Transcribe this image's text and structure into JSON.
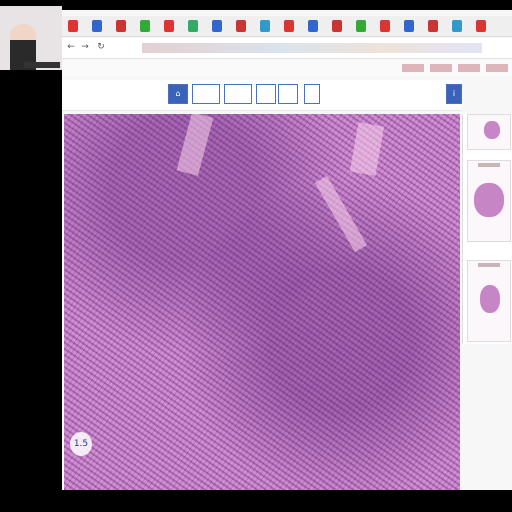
{
  "webcam": {
    "overlay_text": "",
    "icon": "presenter-video"
  },
  "browser": {
    "tabs_icon": "browser-tab-favicon",
    "nav_icons": [
      "back-icon",
      "forward-icon",
      "reload-icon"
    ],
    "address": "",
    "bookmarks_count_visible": 12
  },
  "viewer": {
    "toolbar": {
      "buttons": [
        {
          "label": "",
          "icon": "home-icon"
        },
        {
          "label": "",
          "icon": "tool-button"
        },
        {
          "label": "",
          "icon": "tool-button"
        },
        {
          "label": "",
          "icon": "tool-button"
        },
        {
          "label": "",
          "icon": "tool-button"
        },
        {
          "label": "",
          "icon": "tool-button"
        }
      ],
      "zoom_label": "",
      "end_icon": "info-icon"
    },
    "slide": {
      "scale_label": "1.5"
    },
    "thumbnails": [
      {
        "icon": "slide-thumbnail"
      },
      {
        "icon": "slide-thumbnail"
      },
      {
        "icon": "slide-thumbnail"
      }
    ]
  },
  "colors": {
    "accent": "#3a63b8",
    "tissue": "#c889c9"
  }
}
